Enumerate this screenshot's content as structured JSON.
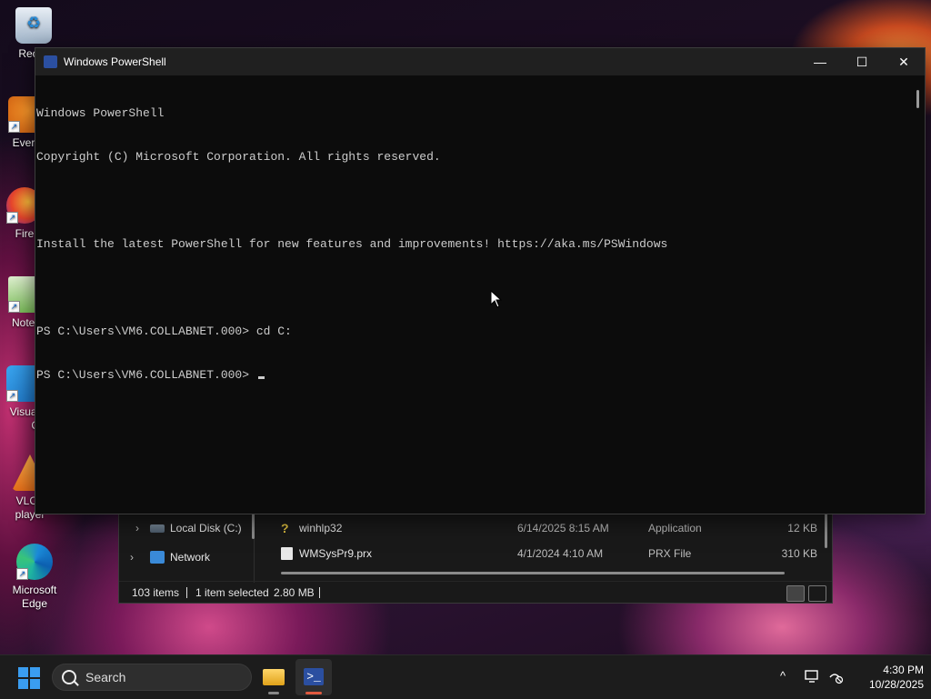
{
  "desktop": {
    "icons": [
      {
        "label": "Recyc",
        "icon": "recycle-bin-icon"
      },
      {
        "label": "Every",
        "icon": "everything-app-icon"
      },
      {
        "label": "Fire",
        "icon": "firefox-icon"
      },
      {
        "label": "Notep",
        "icon": "notepad-icon"
      },
      {
        "label": "Visual",
        "label2": "Co",
        "icon": "vscode-icon"
      },
      {
        "label": "VLC r",
        "label2": "player",
        "icon": "vlc-icon"
      },
      {
        "label": "Microsoft",
        "label2": "Edge",
        "icon": "edge-icon"
      }
    ],
    "shortcut_glyph": "↗"
  },
  "explorer": {
    "nav": [
      {
        "label": "Local Disk (C:)",
        "chevron": "›",
        "icon": "drive-icon"
      },
      {
        "label": "Network",
        "chevron": "›",
        "icon": "network-icon"
      }
    ],
    "files": [
      {
        "name": "winhlp32",
        "date": "6/14/2025 8:15 AM",
        "type": "Application",
        "size": "12 KB",
        "icon": "help-file-icon"
      },
      {
        "name": "WMSysPr9.prx",
        "date": "4/1/2024 4:10 AM",
        "type": "PRX File",
        "size": "310 KB",
        "icon": "generic-file-icon"
      }
    ],
    "status": {
      "items_count": "103 items",
      "selection": "1 item selected",
      "selection_size": "2.80 MB"
    },
    "view_mode": "details"
  },
  "powershell": {
    "title": "Windows PowerShell",
    "controls": {
      "minimize": "—",
      "maximize": "☐",
      "close": "✕"
    },
    "lines": [
      "Windows PowerShell",
      "Copyright (C) Microsoft Corporation. All rights reserved.",
      "",
      "Install the latest PowerShell for new features and improvements! https://aka.ms/PSWindows",
      "",
      "PS C:\\Users\\VM6.COLLABNET.000> cd C:",
      "PS C:\\Users\\VM6.COLLABNET.000> "
    ]
  },
  "taskbar": {
    "search_label": "Search",
    "apps": [
      {
        "name": "File Explorer",
        "icon": "file-explorer-icon",
        "active": false
      },
      {
        "name": "Windows PowerShell",
        "icon": "powershell-icon",
        "active": true
      }
    ],
    "tray": {
      "chevron": "^",
      "icons": [
        "display-icon",
        "network-disconnected-icon"
      ]
    },
    "clock": {
      "time": "4:30 PM",
      "date": "10/28/2025"
    }
  },
  "colors": {
    "accent_blue": "#3a9df0",
    "console_bg": "#0c0c0c",
    "console_text": "#cccccc",
    "titlebar_bg": "#202020",
    "active_indicator": "#e05a40"
  }
}
